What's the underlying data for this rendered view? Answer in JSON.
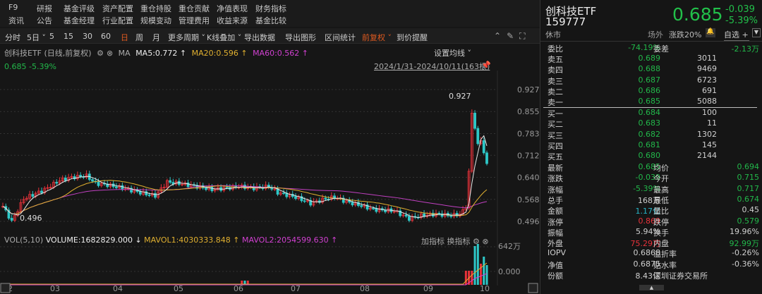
{
  "nav": {
    "row1": [
      "F9",
      "研报",
      "基金评级",
      "资产配置",
      "重仓持股",
      "重仓贡献",
      "净值表现",
      "财务指标"
    ],
    "row2": [
      "资讯",
      "公告",
      "基金经理",
      "行业配置",
      "规模变动",
      "管理费用",
      "收益来源",
      "基金比较"
    ]
  },
  "toolbar": [
    "分时",
    "5日 ˅",
    "5",
    "15",
    "30",
    "60",
    "日",
    "周",
    "月",
    "更多周期 ˅",
    "K线叠加 ˅",
    "导出数据",
    "导出图形",
    "区间统计",
    "前复权 ˅",
    "到价提醒"
  ],
  "toolbar_active": "日",
  "legend": {
    "title": "创科技ETF (日线,前复权)",
    "ma": "MA",
    "ma5": "MA5:0.772 ↑",
    "ma20": "MA20:0.596 ↑",
    "ma60": "MA60:0.562 ↑",
    "last": "0.685 -5.39%"
  },
  "set_ma": "设置均线 ˅",
  "range": "2024/1/31-2024/10/11(163根)",
  "chart_data": {
    "type": "candlestick",
    "price_ticks": [
      "0.927",
      "0.855",
      "0.783",
      "0.712",
      "0.640",
      "0.568",
      "0.496"
    ],
    "ymin": 0.496,
    "ymax": 0.927,
    "max_label": "0.927",
    "min_label": "0.496",
    "months": [
      "02",
      "03",
      "04",
      "05",
      "06",
      "07",
      "08",
      "09",
      "10"
    ],
    "candles": 163,
    "close_keypoints": [
      [
        0,
        0.545
      ],
      [
        3,
        0.496
      ],
      [
        7,
        0.57
      ],
      [
        14,
        0.6
      ],
      [
        19,
        0.63
      ],
      [
        23,
        0.64
      ],
      [
        28,
        0.645
      ],
      [
        31,
        0.62
      ],
      [
        35,
        0.615
      ],
      [
        40,
        0.605
      ],
      [
        44,
        0.595
      ],
      [
        48,
        0.585
      ],
      [
        51,
        0.58
      ],
      [
        55,
        0.625
      ],
      [
        59,
        0.62
      ],
      [
        65,
        0.61
      ],
      [
        70,
        0.6
      ],
      [
        75,
        0.605
      ],
      [
        79,
        0.61
      ],
      [
        84,
        0.605
      ],
      [
        89,
        0.61
      ],
      [
        92,
        0.59
      ],
      [
        98,
        0.575
      ],
      [
        103,
        0.555
      ],
      [
        108,
        0.57
      ],
      [
        111,
        0.575
      ],
      [
        115,
        0.56
      ],
      [
        119,
        0.55
      ],
      [
        124,
        0.535
      ],
      [
        131,
        0.53
      ],
      [
        136,
        0.505
      ],
      [
        140,
        0.515
      ],
      [
        145,
        0.52
      ],
      [
        150,
        0.515
      ],
      [
        153,
        0.52
      ],
      [
        155,
        0.54
      ],
      [
        156,
        0.66
      ],
      [
        157,
        0.85
      ],
      [
        158,
        0.8
      ],
      [
        159,
        0.75
      ],
      [
        160,
        0.76
      ],
      [
        161,
        0.72
      ],
      [
        162,
        0.685
      ]
    ],
    "ma_colors": {
      "ma5": "#e8e8e8",
      "ma20": "#e0b030",
      "ma60": "#c040c0"
    },
    "volume": {
      "label": "VOL(5,10)",
      "volume": "VOLUME:1682829.000 ↓",
      "mavol1": "MAVOL1:4030333.848 ↑",
      "mavol2": "MAVOL2:2054599.630 ↑",
      "ticks": [
        "642万",
        "0.000"
      ]
    }
  },
  "vol_buttons": [
    "加指标",
    "换指标"
  ],
  "quote": {
    "name": "创科技ETF",
    "code": "159777",
    "price": "0.685",
    "change": "-0.039",
    "pct": "-5.39%",
    "status": "休市",
    "market": "场外",
    "limit": "涨跌20%",
    "watch": "自选 +"
  },
  "order": {
    "wb_label": "委比",
    "wb": "-74.19%",
    "wc_label": "委差",
    "wc": "-2.13万",
    "asks": [
      [
        "卖五",
        "0.689",
        "3011"
      ],
      [
        "卖四",
        "0.688",
        "9469"
      ],
      [
        "卖三",
        "0.687",
        "6723"
      ],
      [
        "卖二",
        "0.686",
        "691"
      ],
      [
        "卖一",
        "0.685",
        "5088"
      ]
    ],
    "bids": [
      [
        "买一",
        "0.684",
        "100"
      ],
      [
        "买二",
        "0.683",
        "11"
      ],
      [
        "买三",
        "0.682",
        "1302"
      ],
      [
        "买四",
        "0.681",
        "145"
      ],
      [
        "买五",
        "0.680",
        "2144"
      ]
    ]
  },
  "stats": [
    [
      "最新",
      "0.685",
      "g",
      "均价",
      "0.694",
      "g"
    ],
    [
      "涨跌",
      "-0.039",
      "g",
      "今开",
      "0.715",
      "g"
    ],
    [
      "涨幅",
      "-5.39%",
      "g",
      "最高",
      "0.717",
      "g"
    ],
    [
      "总手",
      "168万",
      "w",
      "最低",
      "0.674",
      "g"
    ],
    [
      "金额",
      "1.17亿",
      "c",
      "量比",
      "0.45",
      "w"
    ],
    [
      "涨停",
      "0.869",
      "r",
      "跌停",
      "0.579",
      "g"
    ],
    [
      "振幅",
      "5.94%",
      "w",
      "换手",
      "19.96%",
      "w"
    ],
    [
      "外盘",
      "75.29万",
      "r",
      "内盘",
      "92.99万",
      "g"
    ],
    [
      "IOPV",
      "0.6868",
      "w",
      "溢折率",
      "-0.26%",
      "w"
    ],
    [
      "净值",
      "0.6875",
      "w",
      "贴水率",
      "-0.36%",
      "w"
    ],
    [
      "份额",
      "8.43亿",
      "w",
      "深圳证券交易所",
      "",
      "w"
    ]
  ]
}
